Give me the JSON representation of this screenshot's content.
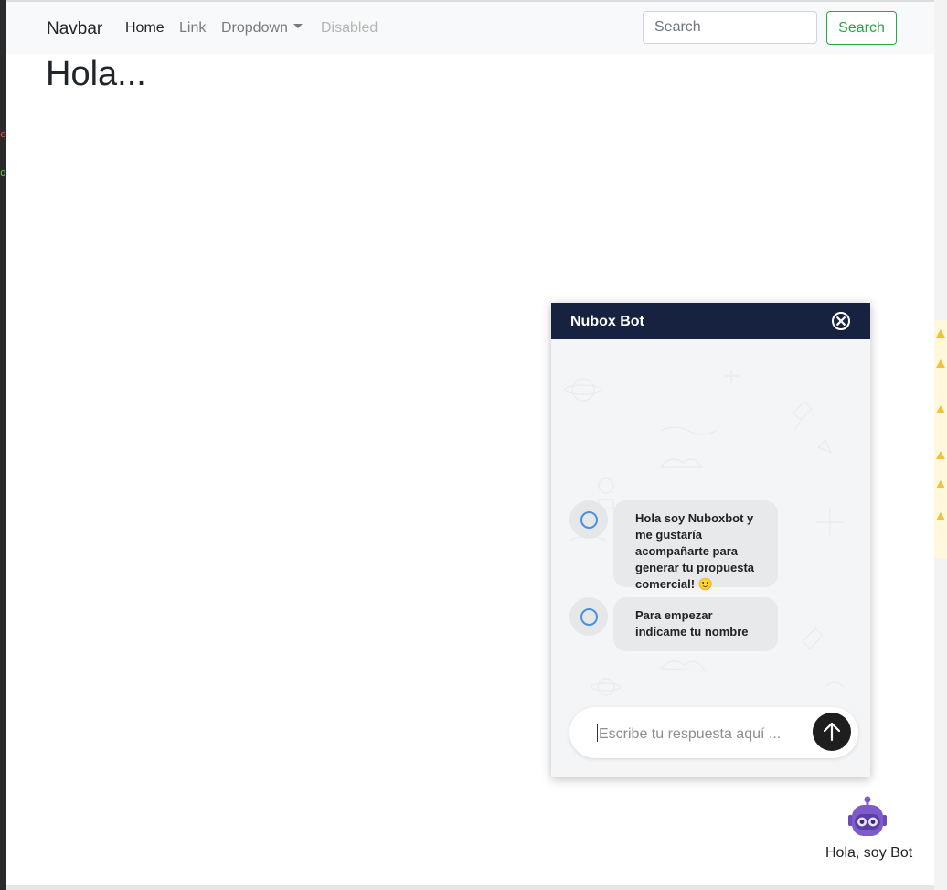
{
  "navbar": {
    "brand": "Navbar",
    "links": [
      {
        "label": "Home",
        "state": "active"
      },
      {
        "label": "Link",
        "state": "normal"
      },
      {
        "label": "Dropdown",
        "state": "dropdown"
      },
      {
        "label": "Disabled",
        "state": "disabled"
      }
    ],
    "search": {
      "placeholder": "Search",
      "value": ""
    },
    "search_button": "Search"
  },
  "page": {
    "heading": "Hola..."
  },
  "chat": {
    "title": "Nubox Bot",
    "messages": [
      {
        "text": "Hola soy Nuboxbot y me gustaría acompañarte para generar tu propuesta comercial! 🙂"
      },
      {
        "text": "Para empezar indícame tu nombre"
      }
    ],
    "input": {
      "placeholder": "Escribe tu respuesta aquí ...",
      "value": ""
    }
  },
  "launcher": {
    "label": "Hola, soy Bot"
  },
  "colors": {
    "accent_green": "#28a745",
    "chat_header": "#16223f",
    "bot_purple": "#7d5bc9",
    "avatar_ring": "#4a8fe0"
  },
  "icons": {
    "close": "close-circle-icon",
    "send": "arrow-up-icon",
    "bot": "robot-icon",
    "avatar": "bot-avatar-icon"
  }
}
